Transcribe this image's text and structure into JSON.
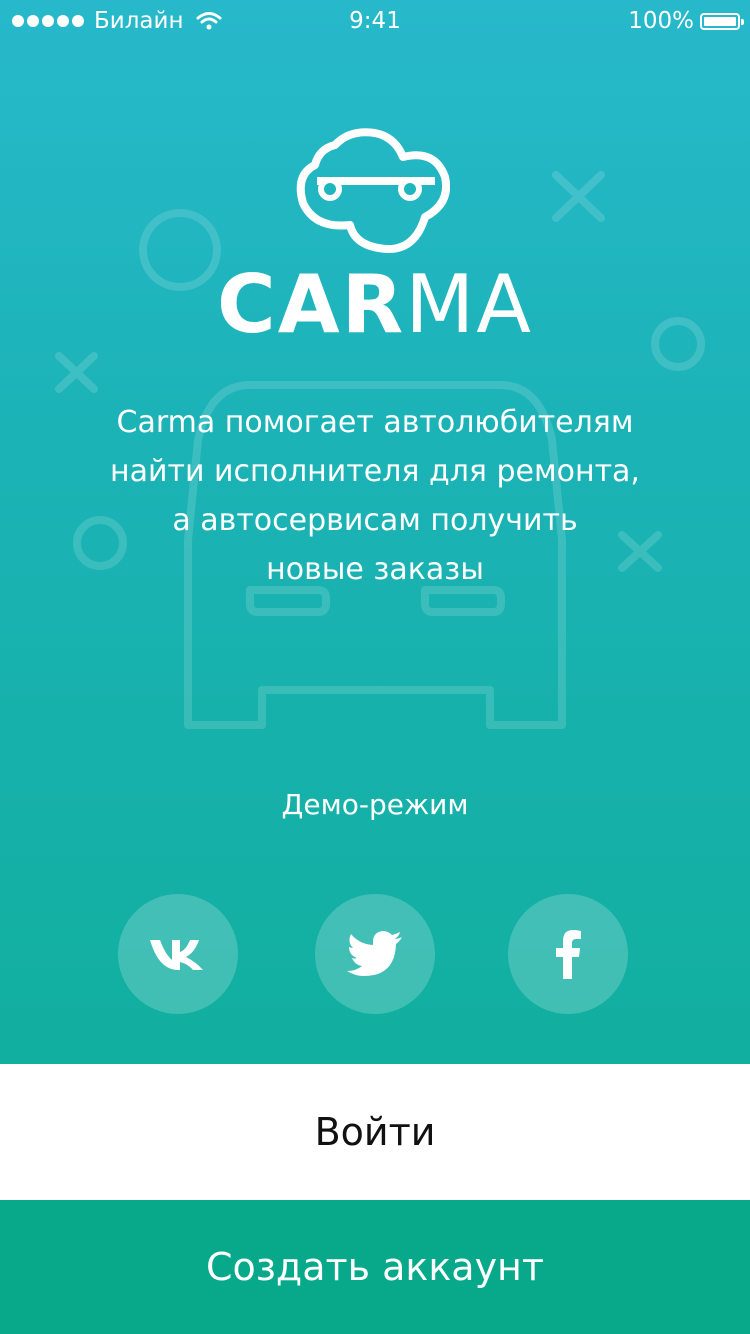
{
  "status_bar": {
    "carrier": "Билайн",
    "time": "9:41",
    "battery": "100%"
  },
  "brand": {
    "name_bold": "CAR",
    "name_light": "MA"
  },
  "tagline": [
    "Carma помогает автолюбителям",
    "найти исполнителя для ремонта,",
    "а автосервисам получить",
    "новые заказы"
  ],
  "demo_link": "Демо-режим",
  "social": [
    {
      "network": "vk",
      "icon": "vk-icon"
    },
    {
      "network": "twitter",
      "icon": "twitter-icon"
    },
    {
      "network": "facebook",
      "icon": "facebook-icon"
    }
  ],
  "buttons": {
    "login": "Войти",
    "signup": "Создать аккаунт"
  },
  "colors": {
    "gradient_top": "#27b9cb",
    "gradient_bottom": "#11af9f",
    "signup_bg": "#07a98a",
    "login_bg": "#ffffff"
  }
}
